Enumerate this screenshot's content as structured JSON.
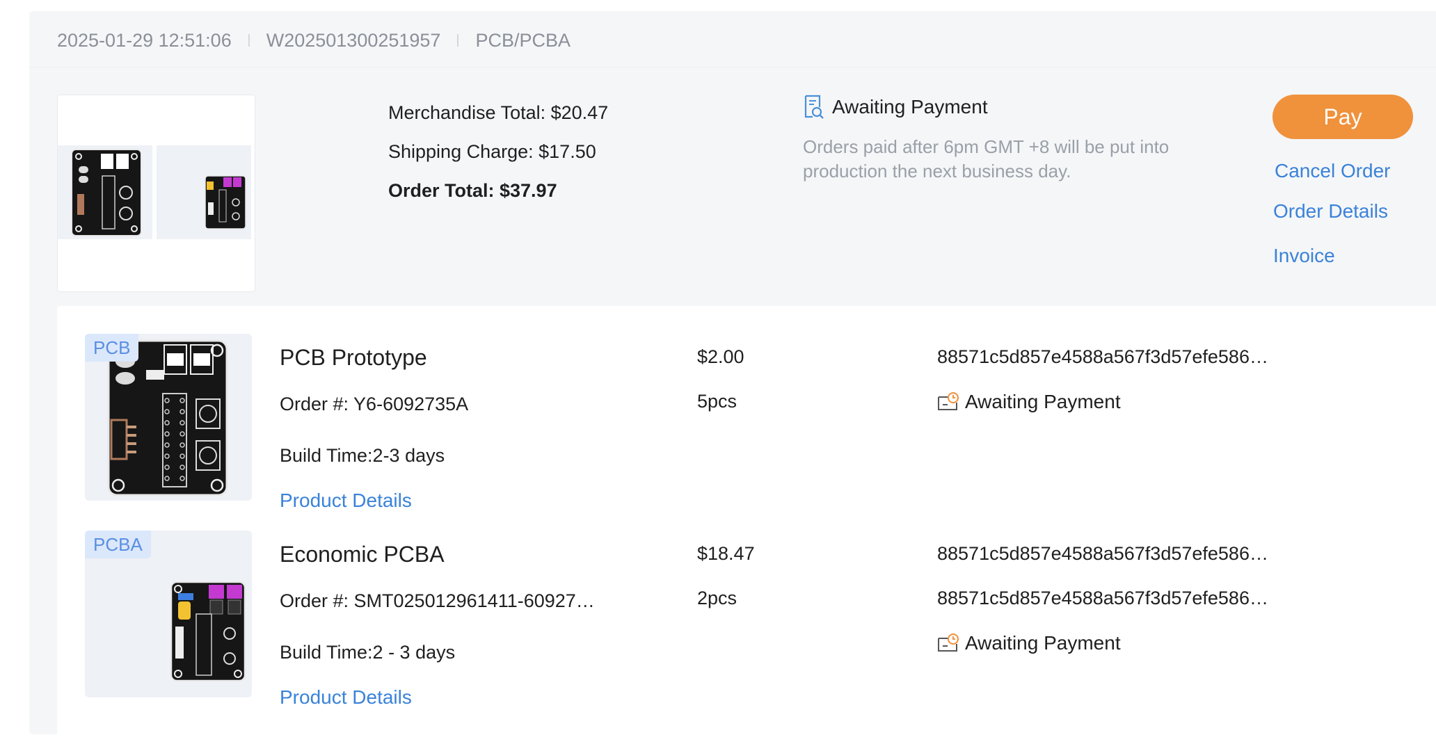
{
  "order": {
    "datetime": "2025-01-29 12:51:06",
    "order_id": "W202501300251957",
    "category": "PCB/PCBA"
  },
  "summary": {
    "merchandise_total": "Merchandise Total: $20.47",
    "shipping_charge": "Shipping Charge: $17.50",
    "order_total": "Order Total: $37.97"
  },
  "status": {
    "label": "Awaiting Payment",
    "note": "Orders paid after 6pm GMT +8 will be put into production the next business day."
  },
  "actions": {
    "pay": "Pay",
    "cancel": "Cancel Order",
    "details": "Order Details",
    "invoice": "Invoice"
  },
  "items": [
    {
      "tag": "PCB",
      "title": "PCB Prototype",
      "order_no": "Order #: Y6-6092735A",
      "build_time": "Build Time:2-3 days",
      "details_link": "Product Details",
      "price": "$2.00",
      "qty": "5pcs",
      "hashes": [
        "88571c5d857e4588a567f3d57efe586…"
      ],
      "status": "Awaiting Payment"
    },
    {
      "tag": "PCBA",
      "title": "Economic PCBA",
      "order_no": "Order #: SMT025012961411-60927…",
      "build_time": "Build Time:2 - 3 days",
      "details_link": "Product Details",
      "price": "$18.47",
      "qty": "2pcs",
      "hashes": [
        "88571c5d857e4588a567f3d57efe586…",
        "88571c5d857e4588a567f3d57efe586…"
      ],
      "status": "Awaiting Payment"
    }
  ],
  "icons": {
    "status_icon": "receipt-search-icon",
    "item_status_icon": "wallet-clock-icon"
  },
  "colors": {
    "accent_orange": "#f0913c",
    "link_blue": "#3a82d8",
    "tag_blue": "#dbe7fb"
  }
}
